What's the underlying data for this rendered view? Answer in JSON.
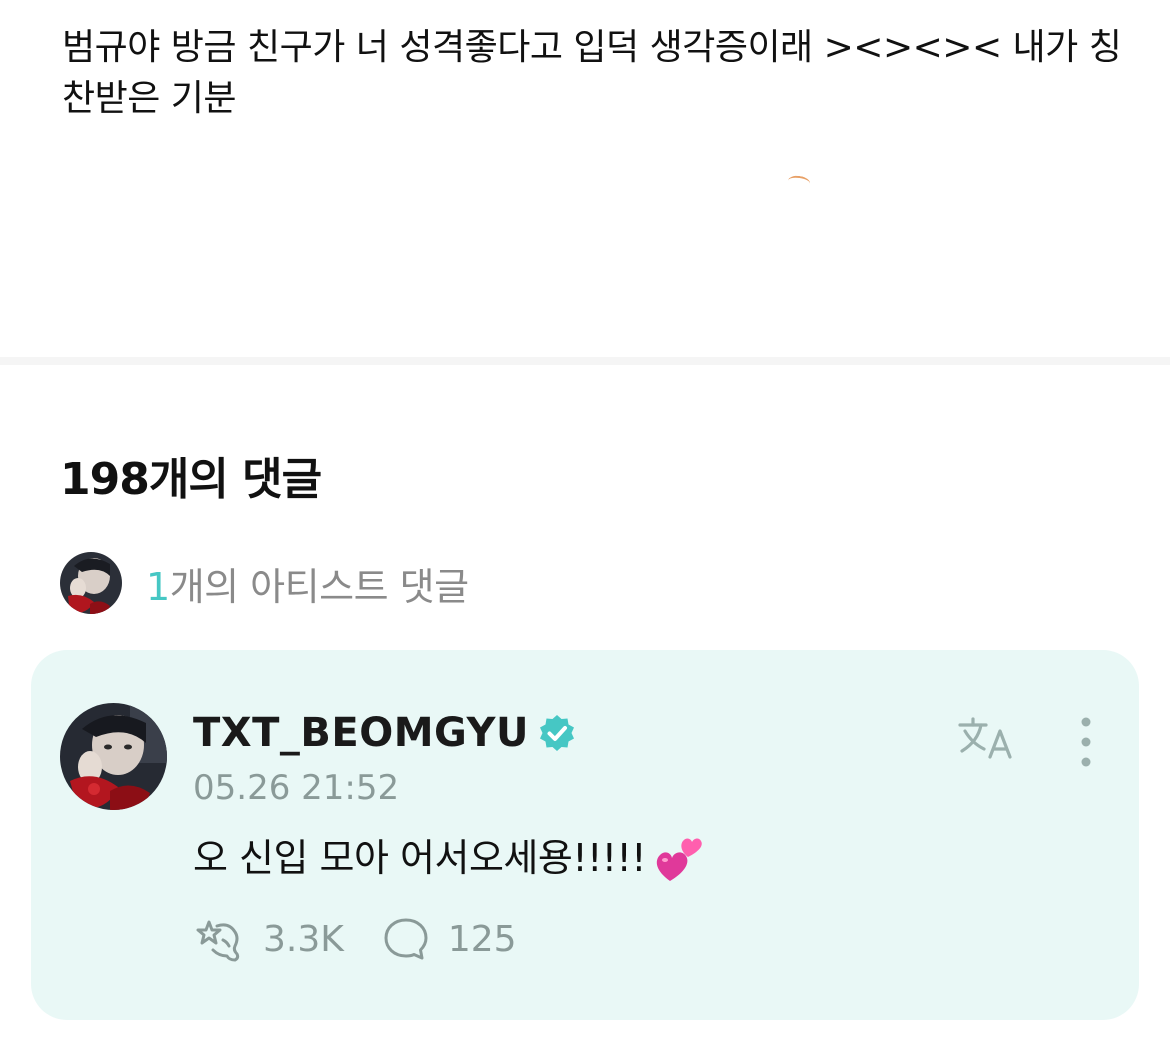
{
  "post": {
    "body": "범규야 방금 친구가 너 성격좋다고 입덕 생각증이래 ><><>< 내가 칭찬받은 기분"
  },
  "comments_section": {
    "heading": "198개의 댓글",
    "artist_comments": {
      "count": "1",
      "label": "개의 아티스트 댓글"
    }
  },
  "artist_comment": {
    "author": "TXT_BEOMGYU",
    "verified": true,
    "timestamp": "05.26 21:52",
    "text": "오 신입 모아 어서오세용!!!!!",
    "emoji": "two-hearts",
    "reactions": {
      "likes": "3.3K",
      "replies": "125"
    }
  },
  "colors": {
    "accent": "#46c7c4",
    "card_background": "#e9f8f6",
    "muted_text": "#8a9a98"
  },
  "icons": [
    "verified-badge-icon",
    "translate-icon",
    "more-options-icon",
    "like-icon",
    "reply-icon",
    "two-hearts-emoji"
  ]
}
